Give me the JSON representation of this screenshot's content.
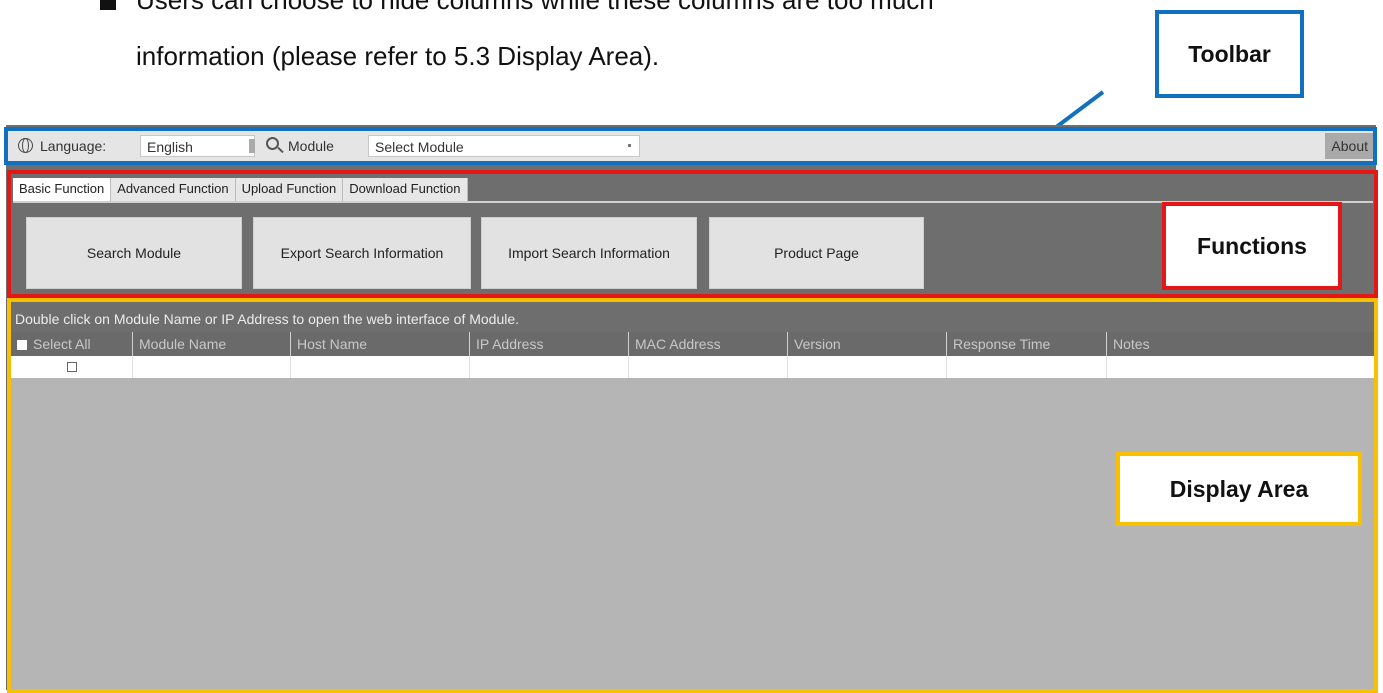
{
  "document": {
    "line1": "Users can choose to hide columns while these columns are too much",
    "line2": "information (please refer to 5.3 Display Area)."
  },
  "callouts": {
    "toolbar": "Toolbar",
    "functions": "Functions",
    "display_area": "Display Area"
  },
  "colors": {
    "toolbar_frame": "#1171c0",
    "functions_frame": "#e41616",
    "display_frame": "#f8c000"
  },
  "toolbar": {
    "language_label": "Language:",
    "language_value": "English",
    "module_label": "Module",
    "module_value": "Select Module",
    "about_label": "About",
    "icons": [
      "globe-icon",
      "search-icon"
    ]
  },
  "tabs": [
    {
      "label": "Basic Function",
      "active": true
    },
    {
      "label": "Advanced Function",
      "active": false
    },
    {
      "label": "Upload Function",
      "active": false
    },
    {
      "label": "Download Function",
      "active": false
    }
  ],
  "function_buttons": [
    "Search Module",
    "Export Search Information",
    "Import Search Information",
    "Product Page"
  ],
  "display": {
    "hint": "Double click on Module Name or IP Address to open the web interface of Module.",
    "columns": [
      "Select All",
      "Module Name",
      "Host Name",
      "IP Address",
      "MAC Address",
      "Version",
      "Response Time",
      "Notes"
    ]
  }
}
